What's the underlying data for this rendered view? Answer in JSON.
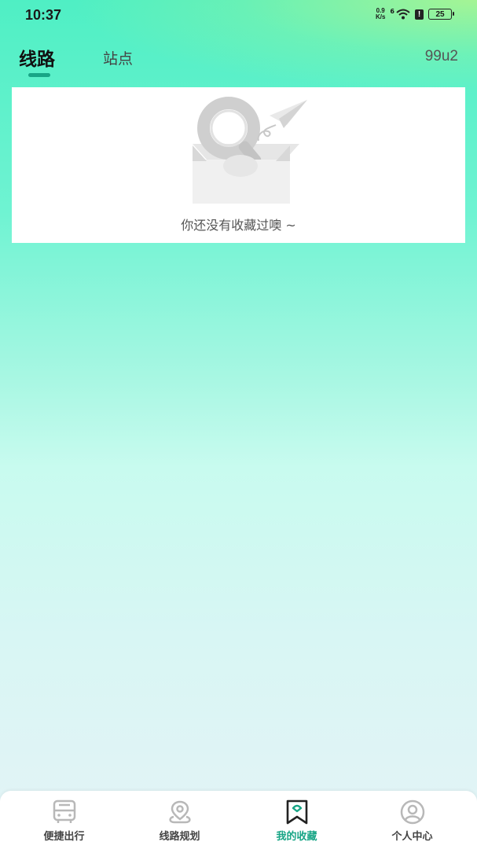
{
  "status_bar": {
    "time": "10:37",
    "net_speed_value": "0.9",
    "net_speed_unit": "K/s",
    "signal_label": "6",
    "battery": "25"
  },
  "tabs": {
    "active": "线路",
    "inactive": "站点",
    "extra": "99u2"
  },
  "empty_state": {
    "message": "你还没有收藏过噢 ~"
  },
  "bottom_nav": [
    {
      "label": "便捷出行",
      "icon": "bus-icon",
      "active": false
    },
    {
      "label": "线路规划",
      "icon": "map-pin-icon",
      "active": false
    },
    {
      "label": "我的收藏",
      "icon": "bookmark-icon",
      "active": true
    },
    {
      "label": "个人中心",
      "icon": "user-icon",
      "active": false
    }
  ],
  "colors": {
    "accent": "#18a586",
    "inactive_icon": "#b8b8b8"
  }
}
